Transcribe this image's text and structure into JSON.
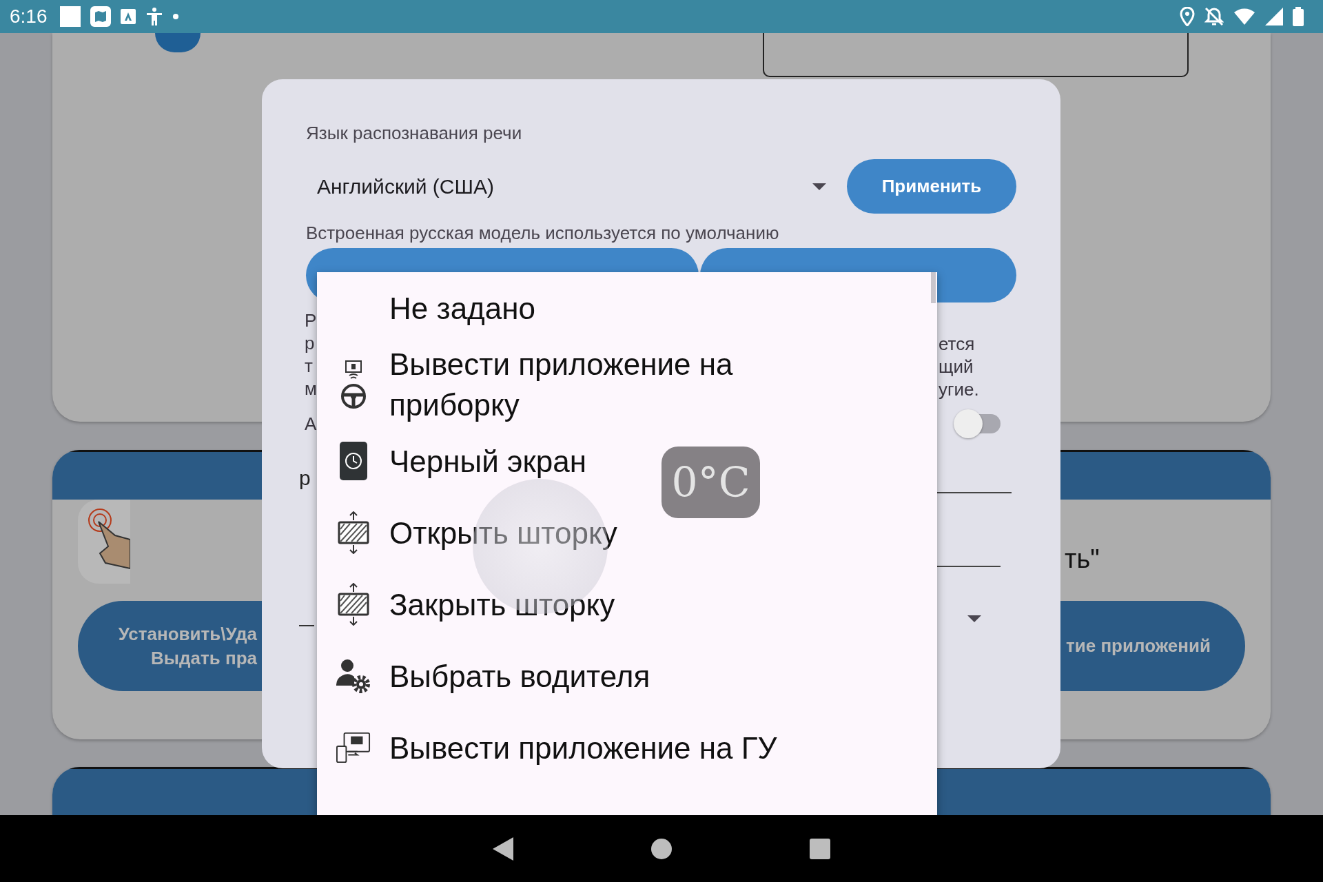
{
  "status_bar": {
    "time": "6:16"
  },
  "background": {
    "left_button_lines": [
      "Установить\\Уда",
      "Выдать пра"
    ],
    "right_label": "ть\"",
    "right_button": "тие приложений"
  },
  "dialog": {
    "language_label": "Язык распознавания речи",
    "language_value": "Английский (США)",
    "apply_button": "Применить",
    "hint": "Встроенная русская модель используется по умолчанию",
    "left_fragments": [
      "Р",
      "р",
      "т",
      "м"
    ],
    "right_fragments": [
      "ется",
      "щий",
      "угие."
    ],
    "switch_label_fragment": "А",
    "switch": {
      "on": false
    },
    "field_fragment": "р"
  },
  "menu": {
    "items": [
      {
        "kind": "none",
        "label": "Не задано"
      },
      {
        "kind": "dashboard",
        "label": "Вывести приложение на приборку"
      },
      {
        "kind": "screen",
        "label": "Черный экран"
      },
      {
        "kind": "curtain",
        "label": "Открыть шторку"
      },
      {
        "kind": "curtain",
        "label": "Закрыть шторку"
      },
      {
        "kind": "driver",
        "label": "Выбрать водителя"
      },
      {
        "kind": "display",
        "label": "Вывести приложение на ГУ"
      }
    ]
  },
  "temperature": "0°C"
}
